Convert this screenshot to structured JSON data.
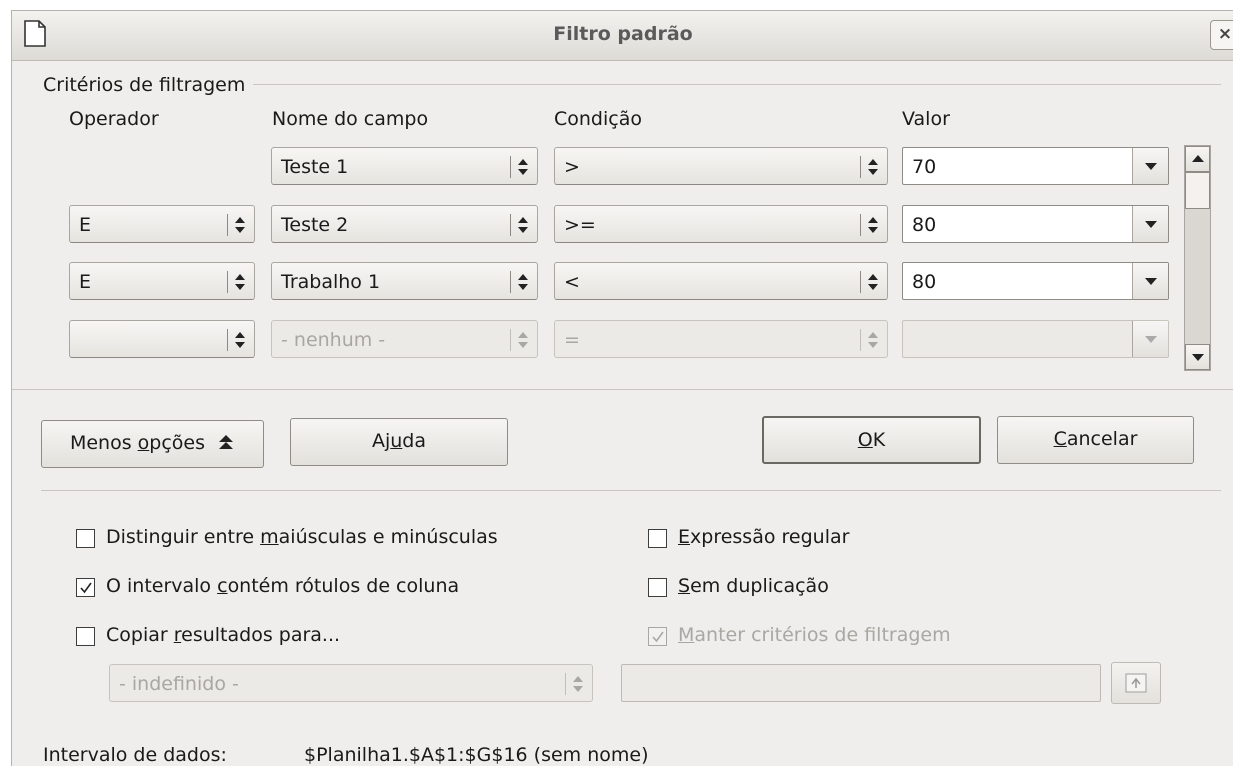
{
  "window": {
    "title": "Filtro padrão",
    "close_glyph": "×"
  },
  "criteria": {
    "section_label": "Critérios de filtragem",
    "headers": {
      "operator": "Operador",
      "field": "Nome do campo",
      "condition": "Condição",
      "value": "Valor"
    },
    "rows": [
      {
        "operator": "",
        "field": "Teste 1",
        "condition": ">",
        "value": "70"
      },
      {
        "operator": "E",
        "field": "Teste 2",
        "condition": ">=",
        "value": "80"
      },
      {
        "operator": "E",
        "field": "Trabalho 1",
        "condition": "<",
        "value": "80"
      },
      {
        "operator": "",
        "field": "- nenhum -",
        "condition": "=",
        "value": ""
      }
    ]
  },
  "buttons": {
    "fewer_options_pre": "Menos ",
    "fewer_options_ul": "o",
    "fewer_options_post": "pções",
    "help_pre": "Aj",
    "help_ul": "u",
    "help_post": "da",
    "ok_ul": "O",
    "ok_post": "K",
    "cancel_ul": "C",
    "cancel_post": "ancelar"
  },
  "options": {
    "case_sensitive": {
      "pre": "Distinguir entre ",
      "ul": "m",
      "post": "aiúsculas e minúsculas",
      "checked": false
    },
    "contains_headers": {
      "pre": "O intervalo ",
      "ul": "c",
      "post": "ontém rótulos de coluna",
      "checked": true
    },
    "copy_results": {
      "pre": "Copiar ",
      "ul": "r",
      "post": "esultados para...",
      "checked": false
    },
    "regex": {
      "pre": "",
      "ul": "E",
      "post": "xpressão regular",
      "checked": false
    },
    "no_duplicates": {
      "pre": "",
      "ul": "S",
      "post": "em duplicação",
      "checked": false
    },
    "keep_criteria": {
      "pre": "",
      "ul": "M",
      "post": "anter critérios de filtragem",
      "checked": true,
      "enabled": false
    }
  },
  "copy_target": {
    "dropdown_value": "- indefinido -",
    "field_value": ""
  },
  "data_range": {
    "label": "Intervalo de dados:",
    "value": "$Planilha1.$A$1:$G$16 (sem nome)"
  },
  "colors": {
    "dialog_bg": "#efeeec",
    "disabled_text": "#a9a7a2"
  }
}
